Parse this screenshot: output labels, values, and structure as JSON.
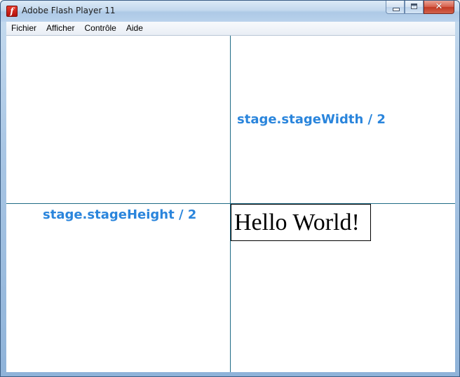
{
  "window": {
    "title": "Adobe Flash Player 11",
    "app_icon": "flash-player-icon",
    "app_icon_glyph": "f",
    "controls": {
      "minimize_icon": "minimize-icon",
      "maximize_icon": "maximize-icon",
      "close_icon": "close-icon",
      "close_glyph": "✕"
    }
  },
  "menu": {
    "items": [
      {
        "label": "Fichier"
      },
      {
        "label": "Afficher"
      },
      {
        "label": "Contrôle"
      },
      {
        "label": "Aide"
      }
    ]
  },
  "stage": {
    "label_width": "stage.stageWidth / 2",
    "label_height": "stage.stageHeight / 2",
    "hello_text": "Hello World!",
    "colors": {
      "guide_line": "#1f6b86",
      "label_text": "#2a85dc",
      "text_box_border": "#000000"
    }
  }
}
